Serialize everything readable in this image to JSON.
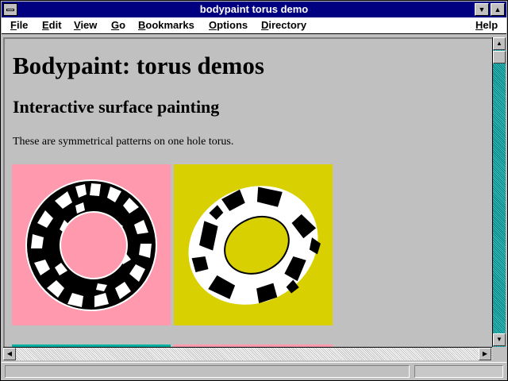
{
  "window": {
    "title": "bodypaint torus demo"
  },
  "menubar": {
    "items": [
      "File",
      "Edit",
      "View",
      "Go",
      "Bookmarks",
      "Options",
      "Directory"
    ],
    "help": "Help"
  },
  "page": {
    "heading": "Bodypaint: torus demos",
    "subheading": "Interactive surface painting",
    "description": "These are symmetrical patterns on one hole torus."
  },
  "demos": [
    {
      "name": "pink-torus",
      "background": "#ff9aae",
      "strip": "#00b0a0"
    },
    {
      "name": "yellow-torus",
      "background": "#d8d000",
      "strip": "#ff9aae"
    }
  ],
  "colors": {
    "titlebar": "#000080",
    "chrome": "#c0c0c0",
    "scroll_track": "#00a0a0"
  },
  "icons": {
    "system_menu": "system-menu-icon",
    "minimize": "triangle-down",
    "maximize": "triangle-up",
    "scroll_up": "triangle-up",
    "scroll_down": "triangle-down",
    "scroll_left": "triangle-left",
    "scroll_right": "triangle-right"
  }
}
